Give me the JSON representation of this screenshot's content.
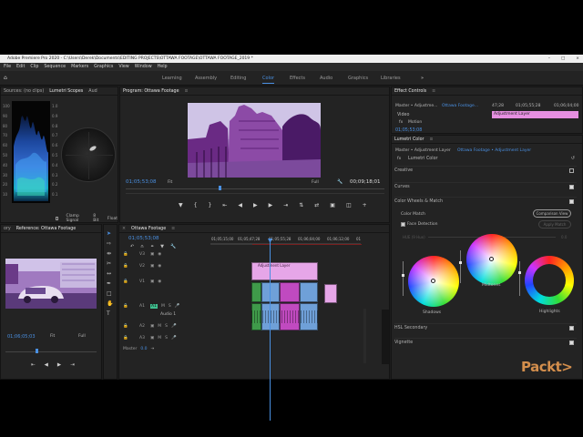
{
  "window": {
    "title": "Adobe Premiere Pro 2020 - C:\\Users\\Derek\\Documents\\EDITING PROJECTS\\OTTAWA FOOTAGE\\OTTAWA FOOTAGE_2019 *",
    "controls": [
      "–",
      "□",
      "×"
    ]
  },
  "menu": [
    "File",
    "Edit",
    "Clip",
    "Sequence",
    "Markers",
    "Graphics",
    "View",
    "Window",
    "Help"
  ],
  "workspaces": {
    "tabs": [
      "Learning",
      "Assembly",
      "Editing",
      "Color",
      "Effects",
      "Audio",
      "Graphics",
      "Libraries"
    ],
    "active": "Color",
    "more": "»"
  },
  "scopes_panel": {
    "tabs": [
      "Sources: (no clips)",
      "Lumetri Scopes",
      "Aud"
    ],
    "y_ticks": [
      "100",
      "90",
      "80",
      "70",
      "60",
      "50",
      "40",
      "30",
      "20",
      "10"
    ],
    "y_ticks_right": [
      "1.0",
      "0.9",
      "0.8",
      "0.7",
      "0.6",
      "0.5",
      "0.4",
      "0.3",
      "0.2",
      "0.1"
    ],
    "bottom": {
      "clamp": "Clamp Signal",
      "bit": "8 Bit",
      "mode": "Float"
    }
  },
  "program_monitor": {
    "tab": "Program: Ottawa Footage",
    "timecode": "01;05;53;08",
    "fit": "Fit",
    "quality": "Full",
    "duration": "00;09;18;01"
  },
  "reference_monitor": {
    "tabs": [
      "ory",
      "Reference: Ottawa Footage"
    ],
    "timecode": "01;06;05;03",
    "fit": "Fit",
    "quality": "Full"
  },
  "timeline": {
    "tab": "Ottawa Footage",
    "timecode": "01;05;53;08",
    "ruler": [
      "01;05;15;00",
      "01;05;47;28",
      "01;05;55;28",
      "01;06;04;00",
      "01;06;12;00",
      "01"
    ],
    "tracks": [
      "V3",
      "V2",
      "V1",
      "A1",
      "A2",
      "A3"
    ],
    "audio_label": "Audio 1",
    "master": "Master",
    "master_value": "0.0",
    "adjustment_clip": "Adjustment Layer"
  },
  "effect_controls": {
    "tab": "Effect Controls",
    "source": "Master • Adjustme...",
    "sequence": "Ottawa Footage...",
    "ruler": [
      "47;28",
      "01;05;55;28",
      "01;06;04;00"
    ],
    "clip_name": "Adjustment Layer",
    "section": "Video",
    "fx": "Motion",
    "timecode": "01;05;53;08"
  },
  "lumetri": {
    "tab": "Lumetri Color",
    "source": "Master • Adjustment Layer",
    "sequence": "Ottawa Footage • Adjustment Layer",
    "fx": "Lumetri Color",
    "sections": [
      "Creative",
      "Curves",
      "Color Wheels & Match"
    ],
    "color_match": "Color Match",
    "comparison_btn": "Comparison View",
    "face_detection": "Face Detection",
    "apply_match": "Apply Match",
    "hue_label": "HUE (9 Hue)",
    "hue_value": "0.0",
    "wheels": [
      "Shadows",
      "Midtones",
      "Highlights"
    ],
    "bottom_sections": [
      "HSL Secondary",
      "Vignette"
    ]
  },
  "watermark": "Packt>"
}
